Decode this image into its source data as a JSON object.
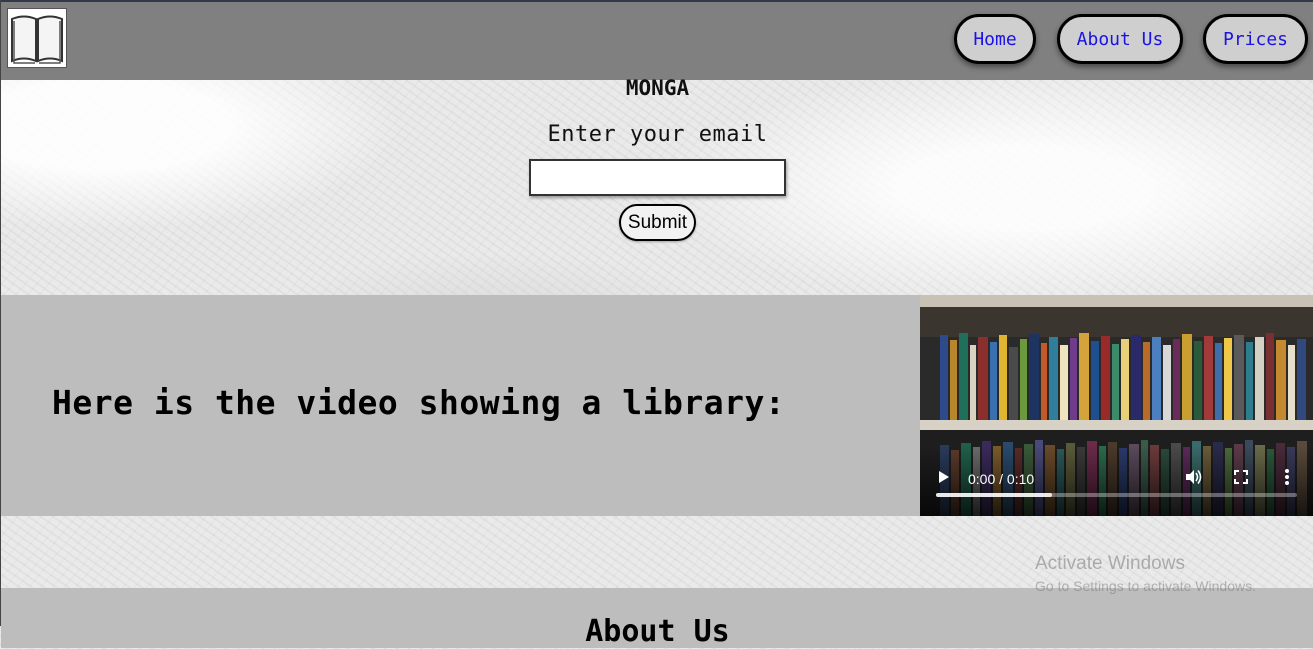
{
  "nav": {
    "logo": "open-book-icon",
    "items": [
      {
        "label": "Home"
      },
      {
        "label": "About Us"
      },
      {
        "label": "Prices"
      }
    ],
    "link_color": "#1a12e6"
  },
  "hero": {
    "brand": "MONGA",
    "email_label": "Enter your email",
    "email_value": "",
    "submit_label": "Submit"
  },
  "video_section": {
    "heading": "Here is the video showing a library:",
    "player": {
      "time": "0:00 / 0:10",
      "progress": 0.32,
      "icons": [
        "play-icon",
        "volume-icon",
        "fullscreen-icon",
        "more-options-icon"
      ]
    }
  },
  "about": {
    "heading": "About Us"
  },
  "watermark": {
    "title": "Activate Windows",
    "subtitle": "Go to Settings to activate Windows."
  },
  "colors": {
    "navbar": "#808080",
    "section_band": "#bdbdbd",
    "button_fill": "#cfcfcf"
  }
}
